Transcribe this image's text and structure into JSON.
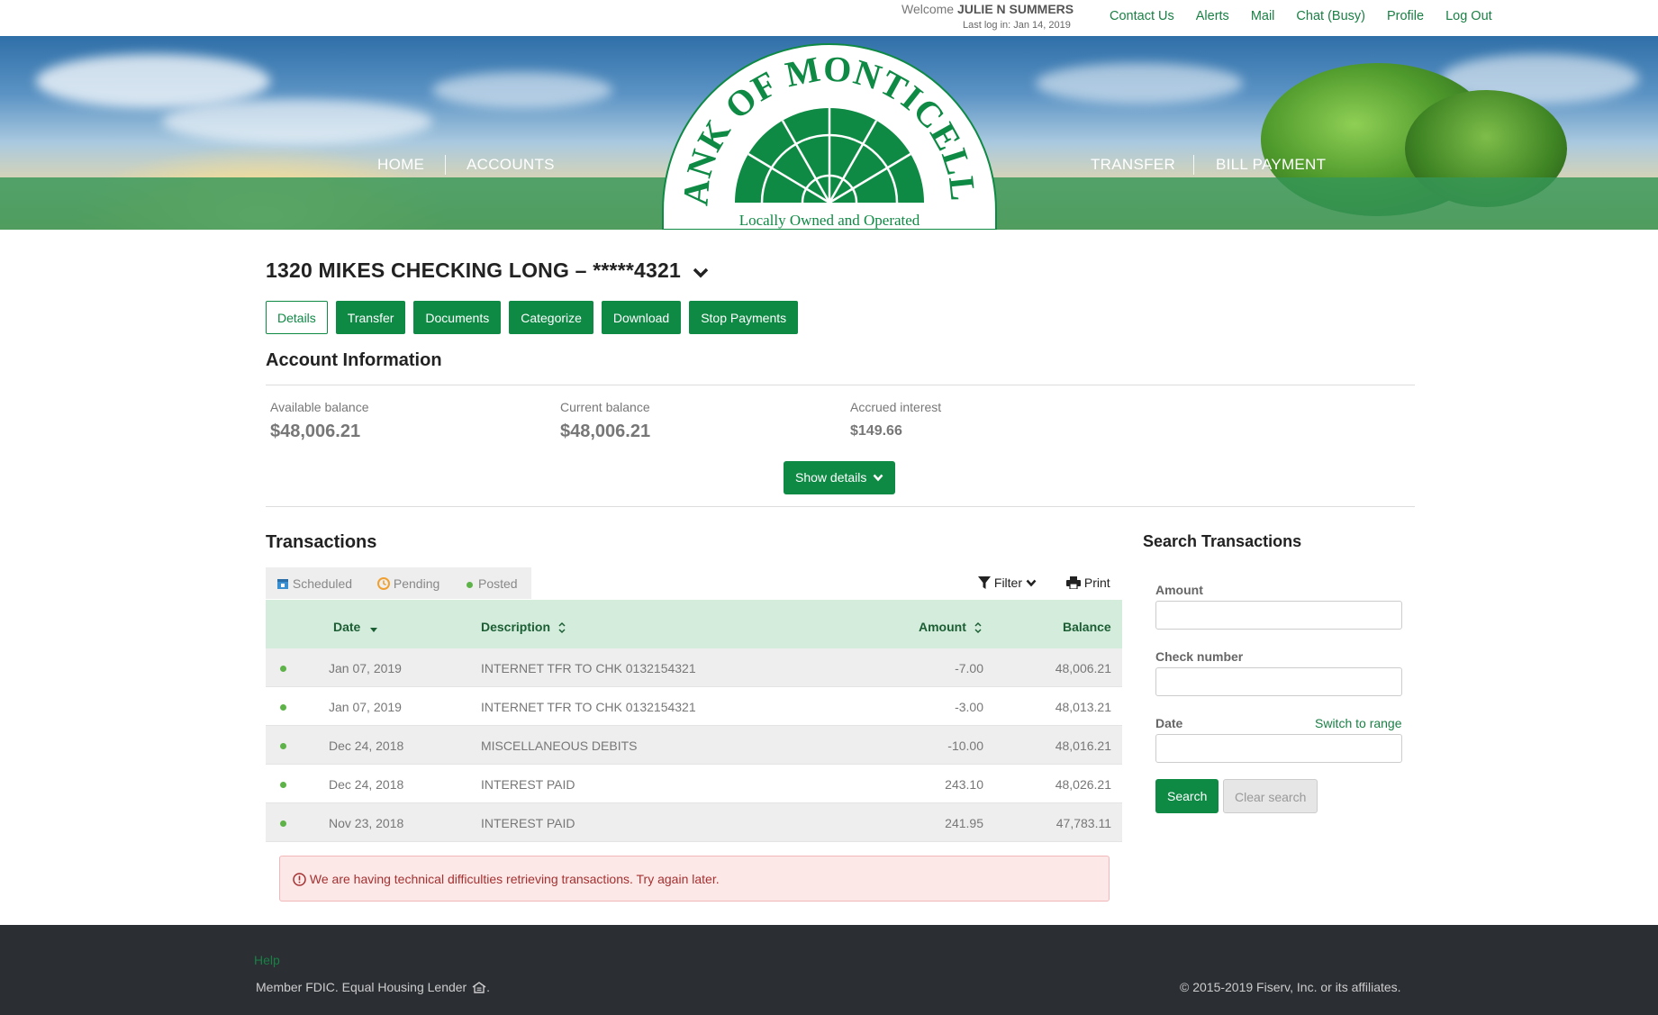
{
  "header": {
    "welcome_prefix": "Welcome",
    "user_name": "JULIE N SUMMERS",
    "last_login": "Last log in: Jan 14, 2019",
    "links": [
      "Contact Us",
      "Alerts",
      "Mail",
      "Chat (Busy)",
      "Profile",
      "Log Out"
    ]
  },
  "logo": {
    "name": "BANK OF MONTICELLO",
    "tagline": "Locally Owned and Operated"
  },
  "nav": {
    "home": "HOME",
    "accounts": "ACCOUNTS",
    "transfer": "TRANSFER",
    "bill_payment": "BILL PAYMENT"
  },
  "account": {
    "title": "1320 MIKES CHECKING LONG – *****4321",
    "tabs": [
      "Details",
      "Transfer",
      "Documents",
      "Categorize",
      "Download",
      "Stop Payments"
    ],
    "active_tab": "Details"
  },
  "account_info": {
    "heading": "Account Information",
    "available_label": "Available balance",
    "available_value": "$48,006.21",
    "current_label": "Current balance",
    "current_value": "$48,006.21",
    "interest_label": "Accrued interest",
    "interest_value": "$149.66",
    "show_details": "Show details"
  },
  "transactions": {
    "heading": "Transactions",
    "status_tabs": [
      "Scheduled",
      "Pending",
      "Posted"
    ],
    "filter": "Filter",
    "print": "Print",
    "columns": {
      "date": "Date",
      "description": "Description",
      "amount": "Amount",
      "balance": "Balance"
    },
    "rows": [
      {
        "date": "Jan 07, 2019",
        "description": "INTERNET TFR TO CHK 0132154321",
        "amount": "-7.00",
        "balance": "48,006.21"
      },
      {
        "date": "Jan 07, 2019",
        "description": "INTERNET TFR TO CHK 0132154321",
        "amount": "-3.00",
        "balance": "48,013.21"
      },
      {
        "date": "Dec 24, 2018",
        "description": "MISCELLANEOUS DEBITS",
        "amount": "-10.00",
        "balance": "48,016.21"
      },
      {
        "date": "Dec 24, 2018",
        "description": "INTEREST PAID",
        "amount": "243.10",
        "balance": "48,026.21"
      },
      {
        "date": "Nov 23, 2018",
        "description": "INTEREST PAID",
        "amount": "241.95",
        "balance": "47,783.11"
      }
    ],
    "error": "We are having technical difficulties retrieving transactions. Try again later."
  },
  "search": {
    "heading": "Search Transactions",
    "amount_label": "Amount",
    "amount_value": "",
    "check_label": "Check number",
    "check_value": "",
    "date_label": "Date",
    "date_value": "",
    "switch_range": "Switch to range",
    "search_btn": "Search",
    "clear_btn": "Clear search"
  },
  "footer": {
    "help": "Help",
    "fdic": "Member FDIC. Equal Housing Lender",
    "copyright": "© 2015-2019 Fiserv, Inc. or its affiliates."
  },
  "colors": {
    "brand_green": "#0f8a45",
    "nav_band": "#349658",
    "table_header": "#d4ecdc",
    "footer_bg": "#2b2e33"
  }
}
